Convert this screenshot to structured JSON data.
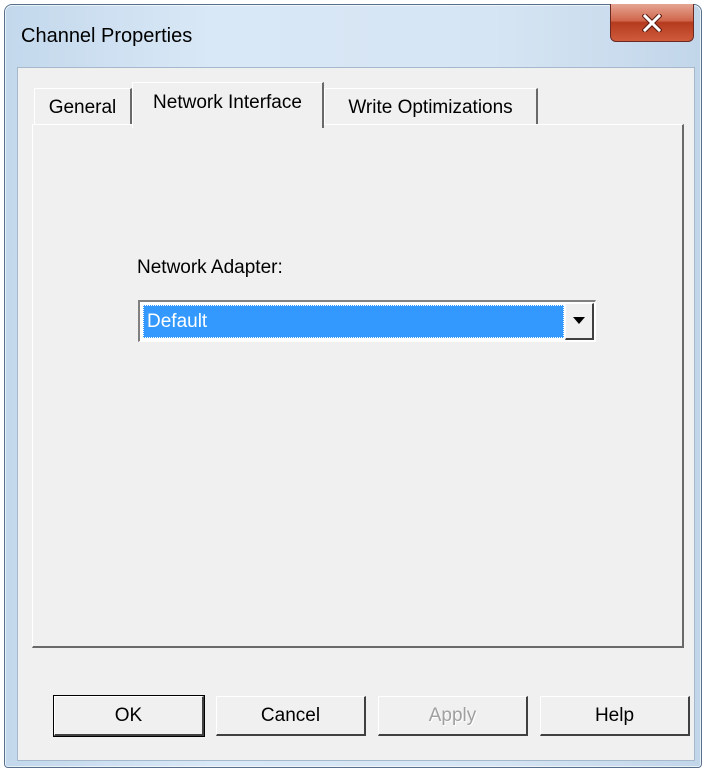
{
  "window": {
    "title": "Channel Properties",
    "close_label": "Close"
  },
  "tabs": [
    {
      "label": "General",
      "selected": false
    },
    {
      "label": "Network Interface",
      "selected": true
    },
    {
      "label": "Write Optimizations",
      "selected": false
    }
  ],
  "network_interface": {
    "adapter_label": "Network Adapter:",
    "adapter_selected": "Default"
  },
  "buttons": {
    "ok": "OK",
    "cancel": "Cancel",
    "apply": "Apply",
    "help": "Help"
  },
  "colors": {
    "selection": "#3399ff",
    "close_button": "#c7482a",
    "dialog_face": "#f0f0f0"
  },
  "icons": {
    "close": "close-icon",
    "dropdown": "chevron-down-icon"
  }
}
